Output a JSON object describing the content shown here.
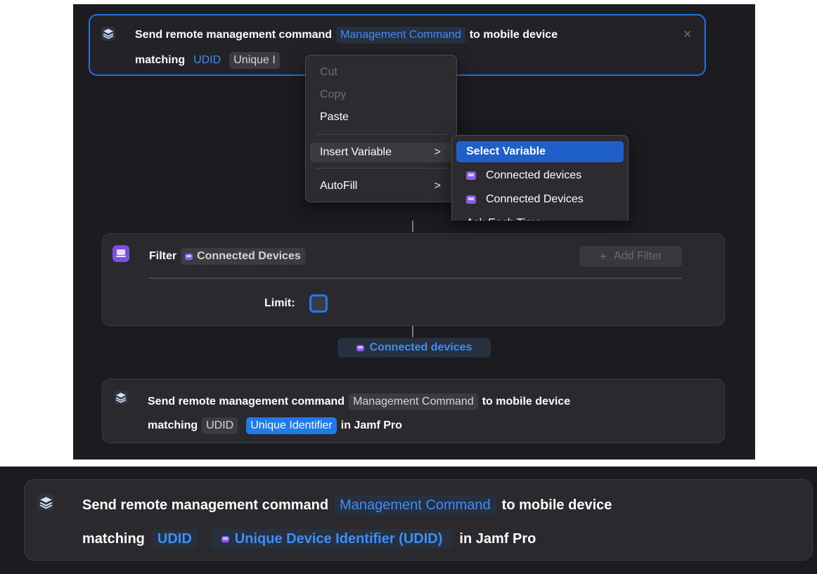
{
  "colors": {
    "canvas": "#1c1c20",
    "card": "#2a2a2e",
    "accent_blue": "#1f7aec",
    "selection_border": "#1e73e6",
    "menu_highlight": "#1f5fc9",
    "device_icon": "#8b5cf6"
  },
  "icons": {
    "action": "jamf-layers-icon",
    "filter": "device-filter-icon",
    "device": "device-icon"
  },
  "top_action": {
    "text1": "Send remote management command",
    "param_command": "Management Command",
    "text2": "to mobile device",
    "text3": "matching",
    "param_udid": "UDID",
    "param_identifier": "Unique I",
    "close_glyph": "×"
  },
  "context_menu": {
    "items": [
      {
        "label": "Cut"
      },
      {
        "label": "Copy"
      },
      {
        "label": "Paste"
      },
      {
        "label": "Insert Variable",
        "chevron": ">"
      },
      {
        "label": "AutoFill",
        "chevron": ">"
      }
    ]
  },
  "submenu": {
    "items": [
      {
        "label": "Select Variable"
      },
      {
        "label": "Connected devices"
      },
      {
        "label": "Connected Devices"
      },
      {
        "label": "Ask Each Time"
      }
    ]
  },
  "filter_action": {
    "label": "Filter",
    "source": "Connected Devices",
    "add_filter": "Add Filter",
    "add_glyph": "+",
    "limit_label": "Limit:"
  },
  "output_variable": {
    "label": "Connected devices"
  },
  "middle_action": {
    "text1": "Send remote management command",
    "param_command": "Management Command",
    "text2": "to mobile device",
    "text3": "matching",
    "param_udid": "UDID",
    "param_identifier": "Unique Identifier",
    "text4": "in Jamf Pro"
  },
  "bottom_action": {
    "text1": "Send remote management command",
    "param_command": "Management Command",
    "text2": "to mobile device",
    "text3": "matching",
    "param_udid": "UDID",
    "param_identifier": "Unique Device Identifier (UDID)",
    "text4": "in Jamf Pro"
  }
}
